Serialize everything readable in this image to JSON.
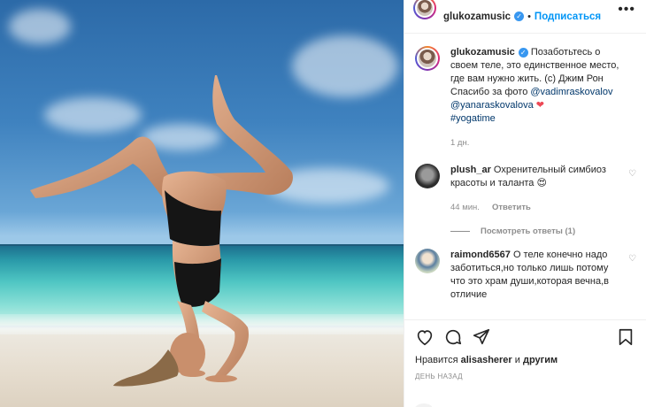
{
  "post": {
    "username": "glukozamusic",
    "follow_label": "Подписаться",
    "separator": "•",
    "more_label": "•••"
  },
  "caption": {
    "username": "glukozamusic",
    "text": "Позаботьтесь о своем теле, это единственное место, где вам нужно жить. (с) Джим Рон Спасибо за фото ",
    "mention1": "@vadimraskovalov",
    "mention2": "@yanaraskovalova",
    "heart": "❤",
    "hashtag": "#yogatime",
    "time": "1 дн."
  },
  "comments": [
    {
      "username": "plush_ar",
      "text": "Охренительный симбиоз красоты и таланта",
      "emoji": "😍",
      "time": "44 мин.",
      "reply_label": "Ответить",
      "view_replies": "Посмотреть ответы (1)"
    },
    {
      "username": "raimond6567",
      "text": "О теле конечно надо заботиться,но только лишь потому что это храм души,которая вечна,в отличие"
    }
  ],
  "footer": {
    "likes_prefix": "Нравится",
    "likes_user": "alisasherer",
    "likes_and": "и",
    "likes_others": "другим",
    "posted_ago": "ДЕНЬ НАЗАД"
  },
  "icons": [
    "heart-icon",
    "comment-icon",
    "share-icon",
    "bookmark-icon",
    "verified-icon"
  ],
  "colors": {
    "accent": "#0095f6",
    "verified": "#3897f0",
    "link": "#00376b",
    "muted": "#8e8e8e"
  }
}
